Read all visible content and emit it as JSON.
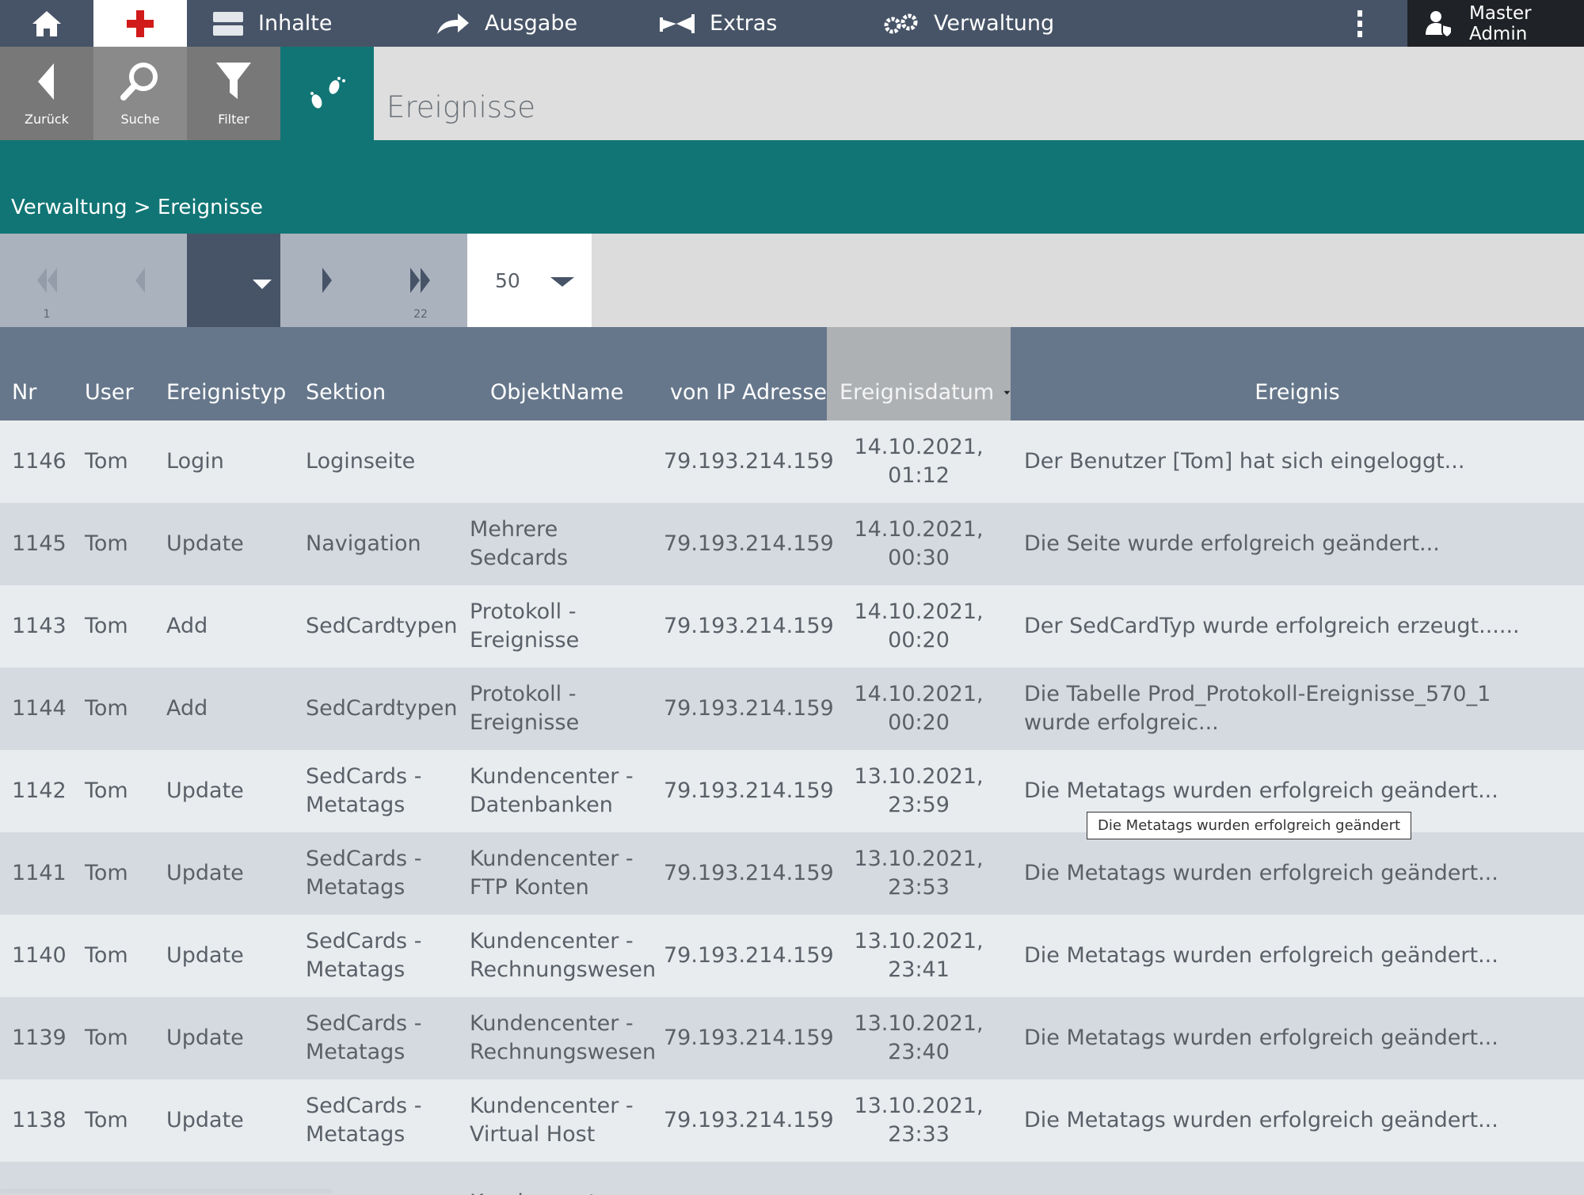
{
  "nav": {
    "items": [
      {
        "label": "Inhalte",
        "icon": "content-icon"
      },
      {
        "label": "Ausgabe",
        "icon": "share-arrow-icon"
      },
      {
        "label": "Extras",
        "icon": "extras-icon"
      },
      {
        "label": "Verwaltung",
        "icon": "gears-icon"
      }
    ],
    "user": "Master Admin"
  },
  "toolbar": {
    "back_label": "Zurück",
    "search_label": "Suche",
    "filter_label": "Filter",
    "page_title": "Ereignisse"
  },
  "breadcrumb": {
    "parent": "Verwaltung",
    "separator": ">",
    "current": "Ereignisse"
  },
  "pager": {
    "first_page": "1",
    "last_page": "22",
    "page_size": "50"
  },
  "table": {
    "columns": [
      "Nr",
      "User",
      "Ereignistyp",
      "Sektion",
      "ObjektName",
      "von IP Adresse",
      "Ereignisdatum",
      "Ereignis"
    ],
    "sorted_column": "Ereignisdatum",
    "rows": [
      {
        "nr": "1146",
        "user": "Tom",
        "typ": "Login",
        "sektion": "Loginseite",
        "objekt": "",
        "ip": "79.193.214.159",
        "datum1": "14.10.2021,",
        "datum2": "01:12",
        "ereignis": "Der Benutzer [Tom] hat sich eingeloggt..."
      },
      {
        "nr": "1145",
        "user": "Tom",
        "typ": "Update",
        "sektion": "Navigation",
        "objekt": "Mehrere Sedcards",
        "ip": "79.193.214.159",
        "datum1": "14.10.2021,",
        "datum2": "00:30",
        "ereignis": "Die Seite wurde erfolgreich geändert..."
      },
      {
        "nr": "1143",
        "user": "Tom",
        "typ": "Add",
        "sektion": "SedCardtypen",
        "objekt": "Protokoll - Ereignisse",
        "ip": "79.193.214.159",
        "datum1": "14.10.2021,",
        "datum2": "00:20",
        "ereignis": "Der SedCardTyp wurde erfolgreich erzeugt......"
      },
      {
        "nr": "1144",
        "user": "Tom",
        "typ": "Add",
        "sektion": "SedCardtypen",
        "objekt": "Protokoll - Ereignisse",
        "ip": "79.193.214.159",
        "datum1": "14.10.2021,",
        "datum2": "00:20",
        "ereignis": "Die Tabelle Prod_Protokoll-Ereignisse_570_1 wurde erfolgreic..."
      },
      {
        "nr": "1142",
        "user": "Tom",
        "typ": "Update",
        "sektion": "SedCards - Metatags",
        "objekt": "Kundencenter - Datenbanken",
        "ip": "79.193.214.159",
        "datum1": "13.10.2021,",
        "datum2": "23:59",
        "ereignis": "Die Metatags wurden erfolgreich geändert..."
      },
      {
        "nr": "1141",
        "user": "Tom",
        "typ": "Update",
        "sektion": "SedCards - Metatags",
        "objekt": "Kundencenter - FTP Konten",
        "ip": "79.193.214.159",
        "datum1": "13.10.2021,",
        "datum2": "23:53",
        "ereignis": "Die Metatags wurden erfolgreich geändert..."
      },
      {
        "nr": "1140",
        "user": "Tom",
        "typ": "Update",
        "sektion": "SedCards - Metatags",
        "objekt": "Kundencenter - Rechnungswesen",
        "ip": "79.193.214.159",
        "datum1": "13.10.2021,",
        "datum2": "23:41",
        "ereignis": "Die Metatags wurden erfolgreich geändert..."
      },
      {
        "nr": "1139",
        "user": "Tom",
        "typ": "Update",
        "sektion": "SedCards - Metatags",
        "objekt": "Kundencenter - Rechnungswesen",
        "ip": "79.193.214.159",
        "datum1": "13.10.2021,",
        "datum2": "23:40",
        "ereignis": "Die Metatags wurden erfolgreich geändert..."
      },
      {
        "nr": "1138",
        "user": "Tom",
        "typ": "Update",
        "sektion": "SedCards - Metatags",
        "objekt": "Kundencenter - Virtual Host",
        "ip": "79.193.214.159",
        "datum1": "13.10.2021,",
        "datum2": "23:33",
        "ereignis": "Die Metatags wurden erfolgreich geändert..."
      },
      {
        "nr": "",
        "user": "",
        "typ": "",
        "sektion": "",
        "objekt": "Kundencenter -",
        "ip": "",
        "datum1": "",
        "datum2": "",
        "ereignis": ""
      }
    ]
  },
  "tooltip": "Die Metatags wurden erfolgreich geändert"
}
